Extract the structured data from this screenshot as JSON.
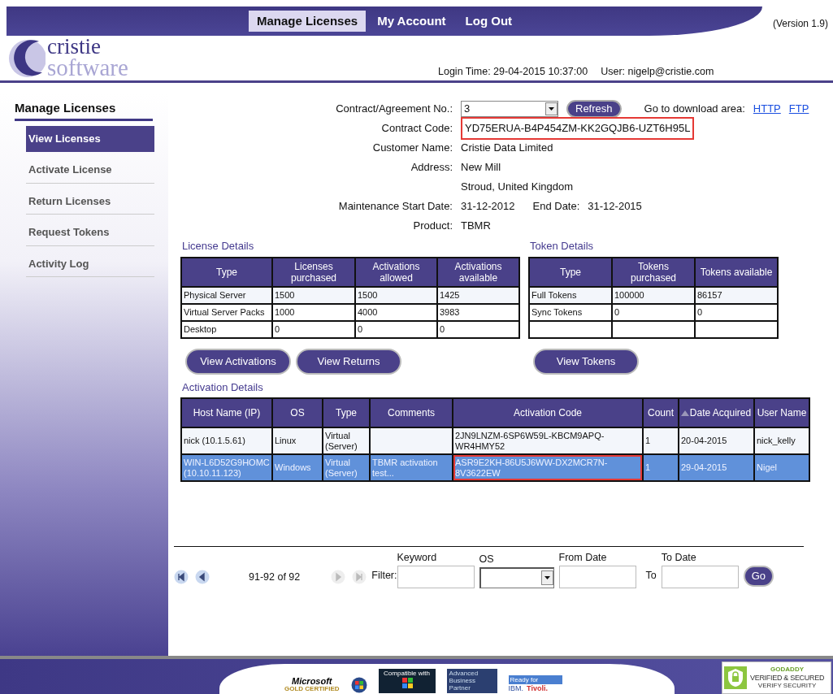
{
  "header": {
    "nav": [
      {
        "label": "Manage Licenses",
        "selected": true
      },
      {
        "label": "My Account",
        "selected": false
      },
      {
        "label": "Log Out",
        "selected": false
      }
    ],
    "version": "(Version 1.9)",
    "logo": {
      "line1": "cristie",
      "line2": "software"
    },
    "login_time": "Login Time: 29-04-2015 10:37:00",
    "user": "User: nigelp@cristie.com"
  },
  "sidebar": {
    "title": "Manage Licenses",
    "items": [
      {
        "label": "View Licenses",
        "selected": true
      },
      {
        "label": "Activate License",
        "selected": false
      },
      {
        "label": "Return Licenses",
        "selected": false
      },
      {
        "label": "Request Tokens",
        "selected": false
      },
      {
        "label": "Activity Log",
        "selected": false
      }
    ]
  },
  "contract": {
    "selector_label": "Contract/Agreement No.:",
    "selector_value": "3",
    "refresh": "Refresh",
    "download_label": "Go to download area:",
    "download_links": [
      "HTTP",
      "FTP"
    ],
    "fields": [
      {
        "label": "Contract Code:",
        "value": "YD75ERUA-B4P454ZM-KK2GQJB6-UZT6H95L",
        "highlighted": true
      },
      {
        "label": "Customer Name:",
        "value": "Cristie Data Limited",
        "highlighted": false
      },
      {
        "label": "Address:",
        "value": "New Mill",
        "highlighted": false
      },
      {
        "value": "Stroud, United Kingdom",
        "highlighted": false
      },
      {
        "label": "Maintenance Start Date:",
        "value": "31-12-2012",
        "extra_label": "End Date:",
        "extra_value": "31-12-2015",
        "highlighted": false
      },
      {
        "label": "Product:",
        "value": "TBMR",
        "highlighted": false
      }
    ]
  },
  "license_details": {
    "title": "License Details",
    "columns": [
      "Type",
      "Licenses purchased",
      "Activations allowed",
      "Activations available"
    ],
    "rows": [
      [
        "Physical Server",
        "1500",
        "1500",
        "1425"
      ],
      [
        "Virtual Server Packs",
        "1000",
        "4000",
        "3983"
      ],
      [
        "Desktop",
        "0",
        "0",
        "0"
      ]
    ],
    "buttons": [
      "View Activations",
      "View Returns"
    ]
  },
  "token_details": {
    "title": "Token Details",
    "columns": [
      "Type",
      "Tokens purchased",
      "Tokens available"
    ],
    "rows": [
      [
        "Full Tokens",
        "100000",
        "86157"
      ],
      [
        "Sync Tokens",
        "0",
        "0"
      ]
    ],
    "buttons": [
      "View Tokens"
    ]
  },
  "activation_details": {
    "title": "Activation Details",
    "columns": [
      {
        "label": "Host Name (IP)",
        "sorted": false
      },
      {
        "label": "OS",
        "sorted": false
      },
      {
        "label": "Type",
        "sorted": false
      },
      {
        "label": "Comments",
        "sorted": false
      },
      {
        "label": "Activation Code",
        "sorted": false
      },
      {
        "label": "Count",
        "sorted": false
      },
      {
        "label": "Date Acquired",
        "sorted": true
      },
      {
        "label": "User Name",
        "sorted": false
      }
    ],
    "rows": [
      {
        "selected": false,
        "code_highlighted": false,
        "cells": [
          "nick (10.1.5.61)",
          "Linux",
          "Virtual (Server)",
          "",
          "2JN9LNZM-6SP6W59L-KBCM9APQ-WR4HMY52",
          "1",
          "20-04-2015",
          "nick_kelly"
        ]
      },
      {
        "selected": true,
        "code_highlighted": true,
        "cells": [
          "WIN-L6D52G9HOMC (10.10.11.123)",
          "Windows",
          "Virtual (Server)",
          "TBMR activation test...",
          "ASR9E2KH-86U5J6WW-DX2MCR7N-8V3622EW",
          "1",
          "29-04-2015",
          "Nigel"
        ]
      }
    ]
  },
  "pager": {
    "controls": [
      {
        "kind": "first",
        "disabled": false
      },
      {
        "kind": "prev",
        "disabled": false
      },
      {
        "kind": "range",
        "text": "91-92 of 92"
      },
      {
        "kind": "next",
        "disabled": true
      },
      {
        "kind": "last",
        "disabled": true
      }
    ],
    "filter_label": "Filter:",
    "fields": [
      {
        "label": "Keyword",
        "kind": "text"
      },
      {
        "label": "OS",
        "kind": "select"
      },
      {
        "label": "From Date",
        "kind": "text"
      },
      {
        "label": "To Date",
        "kind": "text",
        "prefix": "To"
      }
    ],
    "go": "Go"
  },
  "footer": {
    "microsoft": [
      "Microsoft",
      "GOLD CERTIFIED"
    ],
    "compatible": "Compatible with",
    "ibm_partner": [
      "Advanced",
      "Business",
      "Partner"
    ],
    "tivoli": [
      "Ready for",
      "IBM.",
      "Tivoli."
    ],
    "godaddy": [
      "GODADDY",
      "VERIFIED & SECURED",
      "VERIFY SECURITY"
    ]
  }
}
